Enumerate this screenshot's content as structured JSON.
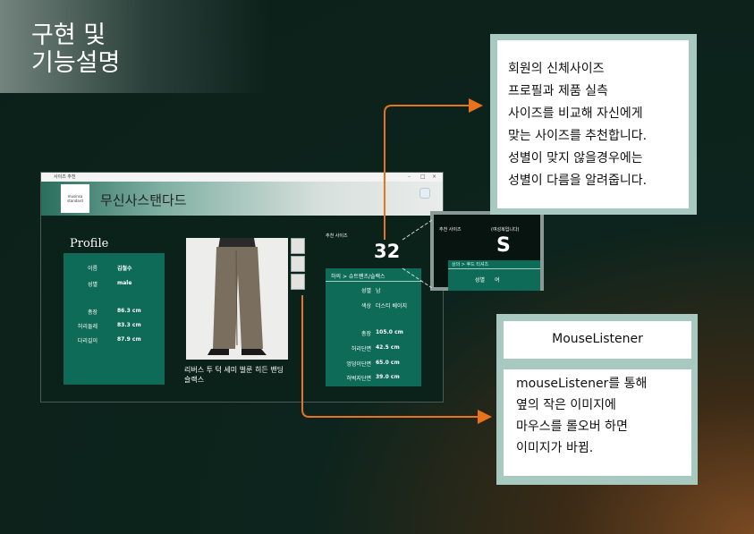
{
  "slide": {
    "title": "구현 및\n기능설명",
    "accent_color": "#e8731c"
  },
  "app": {
    "window_title": "사이즈 추천",
    "logo_text_1": "musinsa",
    "logo_text_2": "standard",
    "name": "무신사스탠다드",
    "profile": {
      "title": "Profile",
      "rows": [
        {
          "label": "이름",
          "value": "김철수"
        },
        {
          "label": "성별",
          "value": "male"
        },
        {
          "label": "총장",
          "value": "86.3 cm"
        },
        {
          "label": "허리둘레",
          "value": "83.3 cm"
        },
        {
          "label": "다리길이",
          "value": "87.9 cm"
        }
      ]
    },
    "product": {
      "name": "리버스 투 턱 세미 벌룬 히든 밴딩 슬랙스"
    },
    "recommend": {
      "label": "추천 사이즈",
      "size": "32"
    },
    "detail": {
      "category": "하의 > 슈트팬츠/슬랙스",
      "rows": [
        {
          "label": "성별",
          "value": "남"
        },
        {
          "label": "색상",
          "value": "더스티 베이지"
        },
        {
          "label": "총장",
          "value": "105.0 cm"
        },
        {
          "label": "허리단면",
          "value": "42.5 cm"
        },
        {
          "label": "엉덩이단면",
          "value": "65.0 cm"
        },
        {
          "label": "허벅지단면",
          "value": "39.0 cm"
        }
      ]
    }
  },
  "zoom": {
    "label": "추천 사이즈",
    "note": "(여성복입니다)",
    "size": "S",
    "category": "상의 > 후드 티셔츠",
    "gender_label": "성별",
    "gender_value": "여"
  },
  "callout1": {
    "lines": [
      "회원의 신체사이즈",
      "프로필과 제품 실측",
      "사이즈를 비교해 자신에게",
      "맞는 사이즈를 추천합니다.",
      "성별이 맞지 않을경우에는",
      "성별이 다름을 알려줍니다."
    ]
  },
  "callout2": {
    "title": "MouseListener",
    "lines": [
      "mouseListener를 통해",
      "옆의 작은 이미지에",
      "마우스를 롤오버 하면",
      "이미지가 바뀜."
    ]
  }
}
